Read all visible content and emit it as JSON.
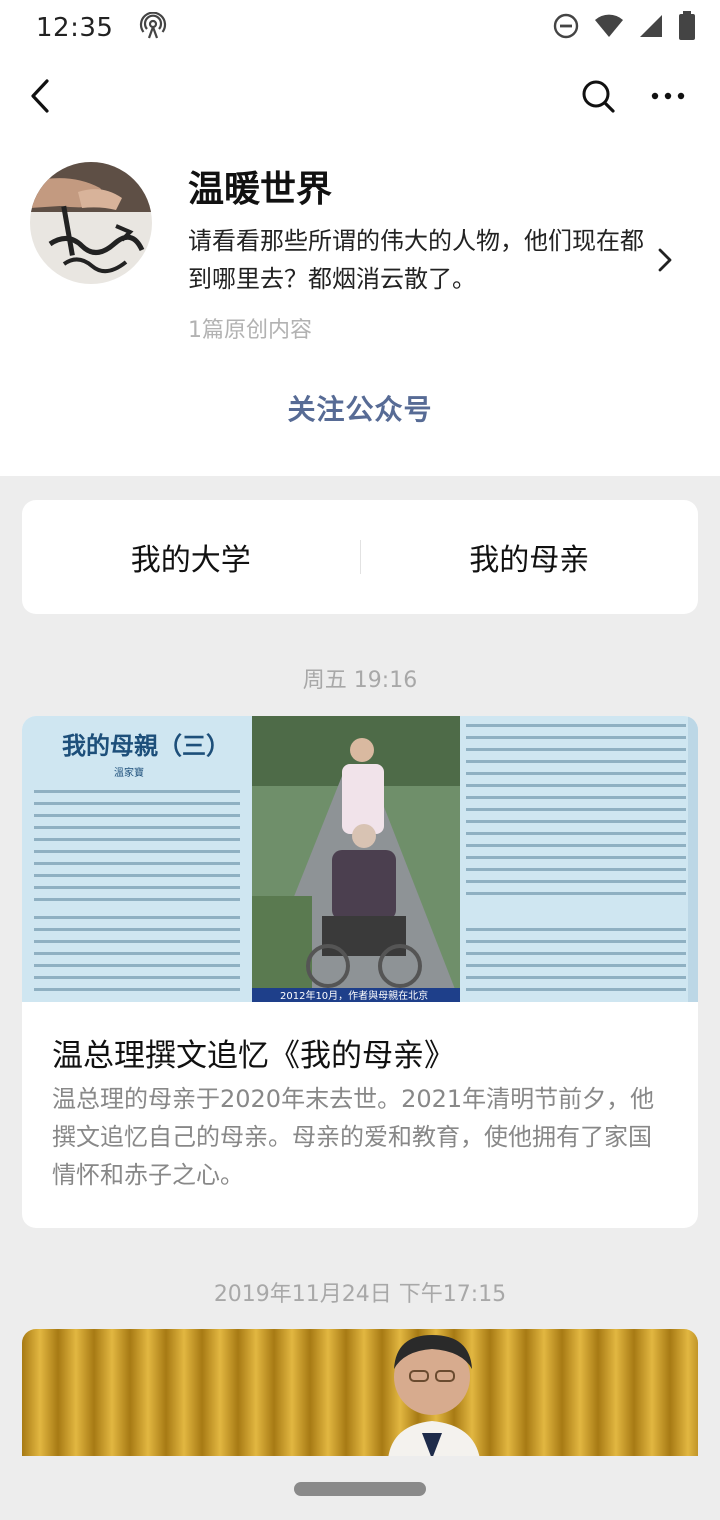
{
  "status_bar": {
    "time": "12:35",
    "icons": [
      "hotspot-icon",
      "do-not-disturb-icon",
      "wifi-icon",
      "cellular-signal-icon",
      "battery-icon"
    ]
  },
  "nav": {
    "icons": [
      "back-icon",
      "search-icon",
      "more-icon"
    ]
  },
  "profile": {
    "name": "温暖世界",
    "description": "请看看那些所谓的伟大的人物，他们现在都到哪里去？都烟消云散了。",
    "original_count": "1篇原创内容",
    "follow_label": "关注公众号"
  },
  "menu": {
    "items": [
      {
        "label": "我的大学"
      },
      {
        "label": "我的母亲"
      }
    ]
  },
  "feed": [
    {
      "timestamp": "周五 19:16",
      "title": "温总理撰文追忆《我的母亲》",
      "summary": "温总理的母亲于2020年末去世。2021年清明节前夕，他撰文追忆自己的母亲。母亲的爱和教育，使他拥有了家国情怀和赤子之心。",
      "cover": {
        "heading": "我的母親（三）",
        "author": "溫家寶",
        "caption": "2012年10月，作者與母親在北京"
      }
    },
    {
      "timestamp": "2019年11月24日 下午17:15"
    }
  ],
  "colors": {
    "link": "#576b95",
    "background": "#ededed",
    "card": "#ffffff",
    "muted": "#b2b2b2"
  }
}
